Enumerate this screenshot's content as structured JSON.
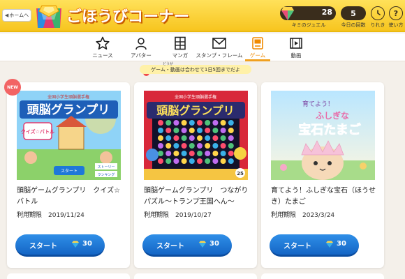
{
  "header": {
    "home_label": "ホームへ",
    "title": "ごほうびコーナー",
    "jewel_count": "28",
    "jewel_label": "キミのジュエル",
    "today_count": "5",
    "today_label": "今日の回数",
    "history_label": "りれき",
    "help_label": "使い方"
  },
  "nav": {
    "items": [
      {
        "label": "ニュース",
        "icon": "star-icon"
      },
      {
        "label": "アバター",
        "icon": "avatar-icon"
      },
      {
        "label": "マンガ",
        "icon": "manga-icon"
      },
      {
        "label": "スタンプ・フレーム",
        "icon": "envelope-icon"
      },
      {
        "label": "ゲーム",
        "icon": "game-icon",
        "active": true
      },
      {
        "label": "動画",
        "icon": "video-icon"
      }
    ]
  },
  "notice": {
    "text": "ゲーム・動画は合わせて1日5回までだよ",
    "ruby": "どうが"
  },
  "cards": [
    {
      "badge": "NEW",
      "title": "頭脳ゲームグランプリ　クイズ☆バトル",
      "ruby": "りようきげん",
      "expire": "利用期限　2019/11/24",
      "start_label": "スタート",
      "cost": "30",
      "thumb_text": [
        "全国小学生頭脳選手権",
        "頭脳グランプリ",
        "クイズ☆バトル",
        "スタート",
        "ストーリー",
        "ランキング"
      ]
    },
    {
      "title": "頭脳ゲームグランプリ　つながりパズル～トランプ王国へん～",
      "ruby": "りようきげん",
      "expire": "利用期限　2019/10/27",
      "start_label": "スタート",
      "cost": "30",
      "thumb_text": [
        "全国小学生頭脳選手権",
        "頭脳グランプリ",
        "25"
      ]
    },
    {
      "title": "育てよう！ふしぎな宝石（ほうせき）たまご",
      "ruby": "りようきげん",
      "expire": "利用期限　2023/3/24",
      "start_label": "スタート",
      "cost": "30",
      "thumb_text": [
        "育てよう！",
        "ふしぎな",
        "宝石たまご"
      ]
    }
  ],
  "colors": {
    "header": "#f7c51f",
    "accent": "#f08a00",
    "start_button": "#1e78d8",
    "new_badge": "#f26464"
  }
}
